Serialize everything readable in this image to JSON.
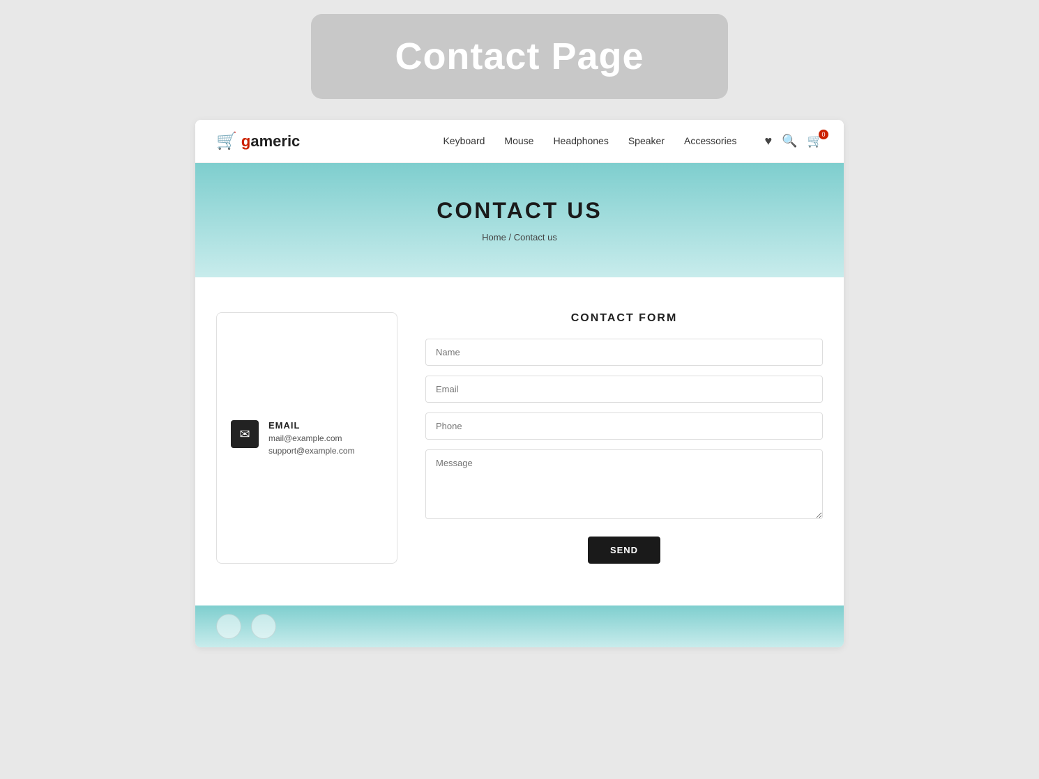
{
  "topBanner": {
    "title": "Contact Page"
  },
  "navbar": {
    "logo": {
      "icon": "🛒",
      "textBefore": "g",
      "brandColor": "#cc2200",
      "textAfter": "americ",
      "fullText": "gameric"
    },
    "navLinks": [
      {
        "label": "Keyboard",
        "href": "#"
      },
      {
        "label": "Mouse",
        "href": "#"
      },
      {
        "label": "Headphones",
        "href": "#"
      },
      {
        "label": "Speaker",
        "href": "#"
      },
      {
        "label": "Accessories",
        "href": "#"
      }
    ],
    "cartBadge": "0"
  },
  "hero": {
    "title": "CONTACT US",
    "breadcrumb": {
      "home": "Home",
      "separator": "/",
      "current": "Contact us"
    }
  },
  "contactInfo": {
    "emailLabel": "EMAIL",
    "emails": [
      "mail@example.com",
      "support@example.com"
    ]
  },
  "contactForm": {
    "title": "CONTACT FORM",
    "fields": {
      "name": {
        "placeholder": "Name"
      },
      "email": {
        "placeholder": "Email"
      },
      "phone": {
        "placeholder": "Phone"
      },
      "message": {
        "placeholder": "Message"
      }
    },
    "sendButton": "SEND"
  }
}
